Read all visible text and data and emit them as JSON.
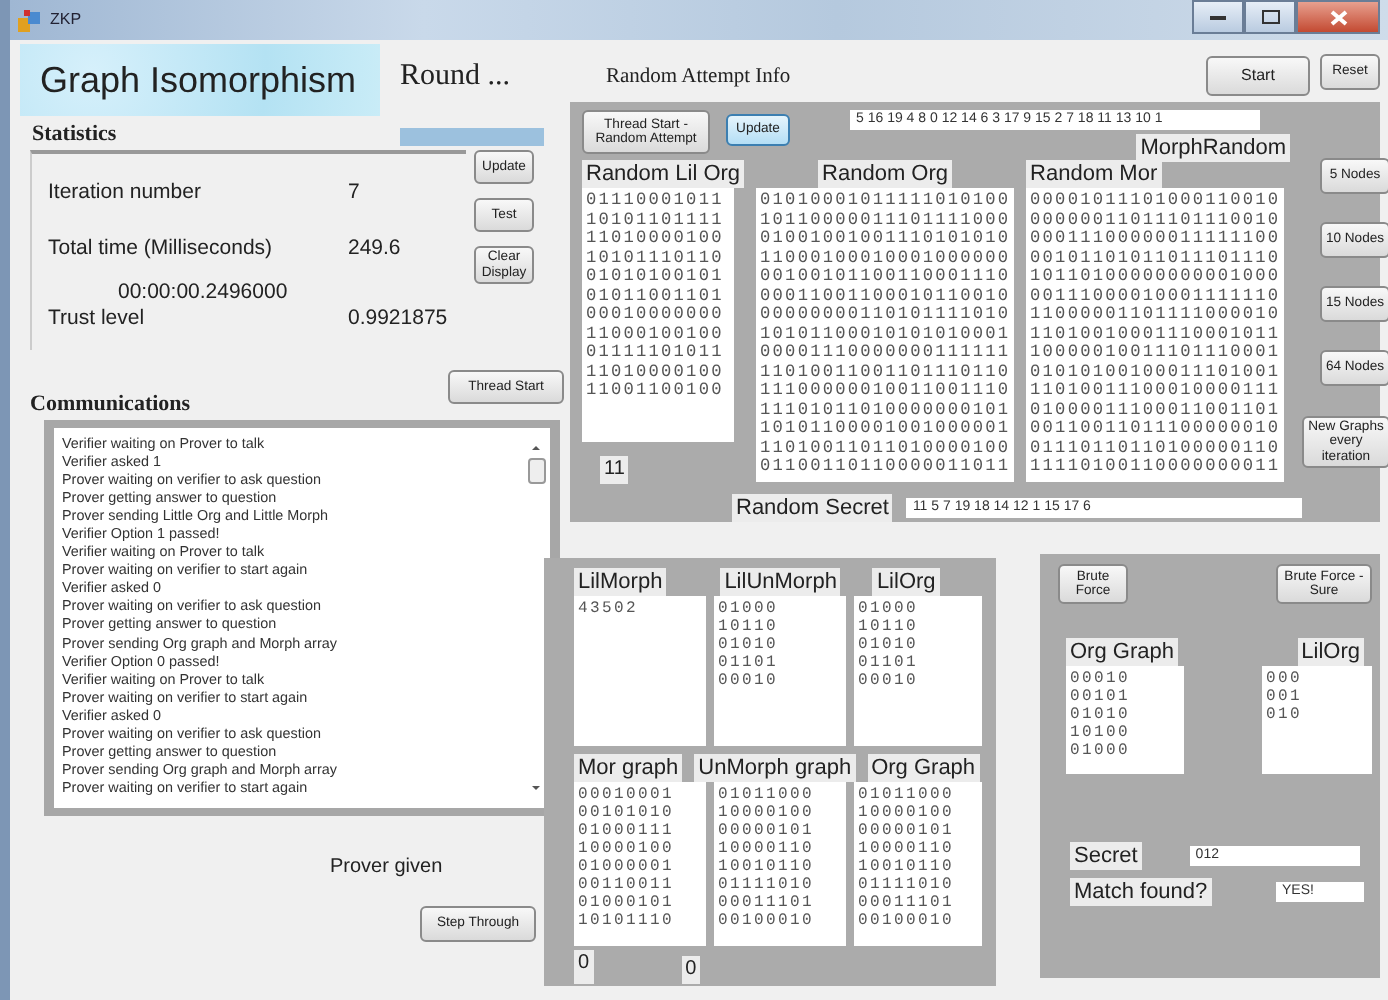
{
  "window": {
    "title": "ZKP"
  },
  "header": {
    "title": "Graph Isomorphism",
    "round": "Round ...",
    "round_progress": {
      "level": 1
    }
  },
  "statistics": {
    "title": "Statistics",
    "rows": [
      {
        "label": "Iteration number",
        "value": "7"
      },
      {
        "label": "Total time (Milliseconds)",
        "value": "249.6"
      },
      {
        "label": "Trust level",
        "value": "0.9921875"
      }
    ],
    "elapsed": "00:00:00.2496000",
    "buttons": [
      "Update",
      "Test",
      "Clear Display"
    ]
  },
  "communications": {
    "title": "Communications",
    "thread_button": "Thread Start",
    "log": [
      "Verifier waiting on Prover to talk",
      "Verifier asked 1",
      "Prover waiting on verifier to ask question",
      "Prover getting answer to question",
      "Prover sending Little Org and Little Morph",
      "Verifier Option 1 passed!",
      "Verifier waiting on Prover to talk",
      "Prover waiting on verifier to start again",
      "Verifier asked 0",
      "Prover waiting on verifier to ask question",
      "Prover getting answer to question",
      "Prover sending Org graph and Morph array",
      "Verifier Option 0 passed!",
      "Verifier waiting on Prover to talk",
      "Prover waiting on verifier to start again",
      "Verifier asked 0",
      "Prover waiting on verifier to ask question",
      "Prover getting answer to question",
      "Prover sending Org graph and Morph array",
      "Prover waiting on verifier to start again"
    ],
    "status": "Prover given",
    "step_button": "Step Through"
  },
  "random_attempt": {
    "title": "Random Attempt Info",
    "start_button": "Start",
    "reset_button": "Reset",
    "thread_button": "Thread Start - Random Attempt",
    "update_button": "Update",
    "permutation": "5 16 19 4 8 0 12 14 6 3 17 9 15 2 7 18 11 13 10 1",
    "permutation_label": "MorphRandom",
    "matrices": [
      {
        "label": "Random Lil Org",
        "rows": [
          "01110001011",
          "10101101111",
          "11010000100",
          "10101110110",
          "01010100101",
          "01011001101",
          "00010000000",
          "11000100100",
          "01111101011",
          "11010000100",
          "11001100100"
        ]
      },
      {
        "label": "Random Org",
        "rows": [
          "01010001011111010100",
          "10110000011101111000",
          "01001001001110101010",
          "11000100010001000000",
          "00100101100110001110",
          "00011001100010110010",
          "00000000110101111010",
          "10101100010101010001",
          "00001110000000111111",
          "11010011001101110110",
          "11100000010011001110",
          "11101011010000000101",
          "10101100001001000001",
          "11010011011010000100",
          "01100110110000011011"
        ]
      },
      {
        "label": "Random Mor",
        "rows": [
          "00001011101000110010",
          "00000011011101110010",
          "00011100000011111100",
          "00101101011011101110",
          "10110100000000001000",
          "00111000010001111110",
          "11000001101111000010",
          "11010010001110001011",
          "10000010011101110001",
          "01010100100011101001",
          "11010011100010000111",
          "01000011100011001101",
          "00110011011100000010",
          "01110110110100000110",
          "11110100110000000011"
        ]
      }
    ],
    "size": "11",
    "node_buttons": [
      "5 Nodes",
      "10 Nodes",
      "15 Nodes",
      "64 Nodes",
      "New Graphs every iteration"
    ],
    "secret_label": "Random Secret",
    "secret": "11 5 7 19 18 14 12 1 15 17 6"
  },
  "little": {
    "matrices": [
      {
        "label": "LilMorph",
        "rows": [
          "43502"
        ]
      },
      {
        "label": "LilUnMorph",
        "rows": [
          "01000",
          "10110",
          "01010",
          "01101",
          "00010"
        ]
      },
      {
        "label": "LilOrg",
        "rows": [
          "01000",
          "10110",
          "01010",
          "01101",
          "00010"
        ]
      },
      {
        "label": "Mor graph",
        "rows": [
          "00010001",
          "00101010",
          "01000111",
          "10000100",
          "01000001",
          "00110011",
          "01000101",
          "10101110"
        ]
      },
      {
        "label": "UnMorph graph",
        "rows": [
          "01011000",
          "10000100",
          "00000101",
          "10000110",
          "10010110",
          "01111010",
          "00011101",
          "00100010"
        ]
      },
      {
        "label": "Org Graph",
        "rows": [
          "01011000",
          "10000100",
          "00000101",
          "10000110",
          "10010110",
          "01111010",
          "00011101",
          "00100010"
        ]
      }
    ],
    "counters": [
      "0",
      "0"
    ]
  },
  "brute_force": {
    "buttons": [
      "Brute Force",
      "Brute Force - Sure"
    ],
    "matrices": [
      {
        "label": "Org Graph",
        "rows": [
          "00010",
          "00101",
          "01010",
          "10100",
          "01000"
        ]
      },
      {
        "label": "LilOrg",
        "rows": [
          "000",
          "001",
          "010"
        ]
      }
    ],
    "secret_label": "Secret",
    "secret": "012",
    "match_label": "Match found?",
    "match": "YES!"
  }
}
